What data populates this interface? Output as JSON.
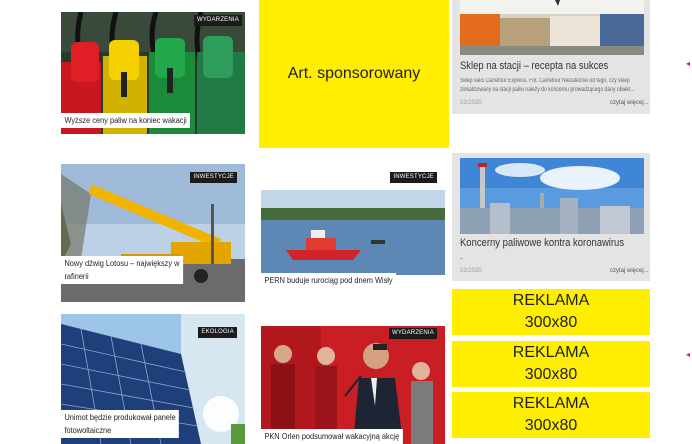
{
  "sponsored_box": {
    "label": "Art. sponsorowany"
  },
  "articles": [
    {
      "tag": "WYDARZENIA",
      "title": "Wyższe ceny paliw na koniec wakacji"
    },
    {
      "tag": "INWESTYCJE",
      "title": "Nowy dźwig Lotosu – największy w",
      "title_line2": "rafinerii"
    },
    {
      "tag": "INWESTYCJE",
      "title": "PERN buduje rurociąg pod dnem Wisły"
    },
    {
      "tag": "EKOLOGIA",
      "title": "Unimot będzie produkował panele",
      "title_line2": "fotowoltaiczne"
    },
    {
      "tag": "WYDARZENIA",
      "title": "PKN Orlen podsumował wakacyjną akcję"
    }
  ],
  "side_articles": [
    {
      "title": "Sklep na stacji – recepta na sukces",
      "desc_line1": "Sklep sieci Carrefour Express. Fot. Carrefour Niezależnie od tego, czy sklep",
      "desc_line2": "zlokalizowany na stacji paliw należy do koncernu prowadzącego dany obiekt...",
      "date": "02/2020",
      "more": "czytaj więcej..."
    },
    {
      "title": "Koncerny paliwowe kontra koronawirus",
      "desc_line1": "–",
      "date": "02/2020",
      "more": "czytaj więcej..."
    }
  ],
  "ads": [
    {
      "line1": "REKLAMA",
      "line2": "300x80"
    },
    {
      "line1": "REKLAMA",
      "line2": "300x80"
    },
    {
      "line1": "REKLAMA",
      "line2": "300x80"
    }
  ],
  "side_arrows": [
    "◂",
    "◂"
  ]
}
